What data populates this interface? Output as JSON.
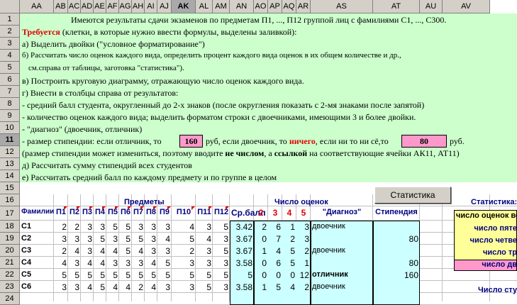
{
  "columns": [
    "AA",
    "AB",
    "AC",
    "AD",
    "AE",
    "AF",
    "AG",
    "AH",
    "AI",
    "AJ",
    "AK",
    "AL",
    "AM",
    "AN",
    "AO",
    "AP",
    "AQ",
    "AR",
    "AS",
    "AT",
    "AU",
    "AV"
  ],
  "selected_column": "AK",
  "rows": [
    "1",
    "2",
    "3",
    "4",
    "5",
    "6",
    "7",
    "8",
    "9",
    "10",
    "11",
    "12",
    "13",
    "14",
    "15",
    "16",
    "17",
    "18",
    "19",
    "20",
    "21",
    "22",
    "23",
    "24"
  ],
  "selected_row": "11",
  "task": {
    "line1": "Имеются результаты сдачи экзаменов по предметам П1, ..., П12 группой лиц с фамилиями С1, ..., С300.",
    "line2_red": "Требуется",
    "line2_rest": " (клетки, в которые нужно ввести формулы, выделены заливкой):",
    "line3": "а) Выделить двойки (\"условное форматирование\")",
    "line4": "б) Рассчитать число оценок каждого вида, определить процент каждого вида оценок в их общем количестве и др.,",
    "line5": "    см.справа от таблицы, заготовка \"статистика\").",
    "line6": "в) Построить круговую диаграмму, отражающую число оценок каждого вида.",
    "line7": "г) Внести в столбцы справа от результатов:",
    "line8": "   - средний балл студента, округленный до 2-х знаков (после округления показать с 2-мя знаками после запятой)",
    "line9": "   - количество оценок каждого вида; выделить форматом строки с двоечниками, имеющими 3 и более двойки.",
    "line10": "   - \"диагноз\" (двоечник, отличник)",
    "line11_a": "   - размер стипендии: если отличник, то",
    "line11_val1": "160",
    "line11_b": "руб, если двоечник, то",
    "line11_bold": "ничего",
    "line11_c": ", если ни то ни сё,то",
    "line11_val2": "80",
    "line11_d": "руб.",
    "line12_a": "     (размер стипендии может измениться, поэтому вводите",
    "line12_b1": "не числом",
    "line12_c": ", а",
    "line12_b2": "ссылкой",
    "line12_d": " на соответствующие ячейки АК11, АТ11)",
    "line13": "д) Рассчитать сумму стипендий всех студентов",
    "line14": "е) Рассчитать средний балл по каждому предмету и по группе в целом"
  },
  "button_label": "Статистика",
  "table": {
    "subjects_header": "Предметы",
    "counts_header": "Число оценок",
    "col_surname": "Фамилии",
    "subject_cols": [
      "П1",
      "П2",
      "П3",
      "П4",
      "П5",
      "П6",
      "П7",
      "П8",
      "П9",
      "П10",
      "П11",
      "П12"
    ],
    "col_avg": "Ср.балл",
    "grade_cols": [
      "2",
      "3",
      "4",
      "5"
    ],
    "col_diag": "\"Диагноз\"",
    "col_stip": "Стипендия",
    "rows": [
      {
        "name": "С1",
        "grades": [
          "2",
          "2",
          "3",
          "3",
          "5",
          "5",
          "3",
          "3",
          "3",
          "4",
          "3",
          "5"
        ],
        "avg": "3.42",
        "counts": [
          "2",
          "6",
          "1",
          "3"
        ],
        "diag": "двоечник",
        "stip": ""
      },
      {
        "name": "С2",
        "grades": [
          "3",
          "3",
          "3",
          "5",
          "3",
          "5",
          "5",
          "3",
          "4",
          "5",
          "4",
          "3"
        ],
        "avg": "3.67",
        "counts": [
          "0",
          "7",
          "2",
          "3"
        ],
        "diag": "",
        "stip": "80"
      },
      {
        "name": "С3",
        "grades": [
          "2",
          "4",
          "3",
          "4",
          "4",
          "5",
          "4",
          "3",
          "3",
          "2",
          "3",
          "5"
        ],
        "avg": "3.67",
        "counts": [
          "1",
          "4",
          "5",
          "2"
        ],
        "diag": "двоечник",
        "stip": ""
      },
      {
        "name": "С4",
        "grades": [
          "4",
          "3",
          "4",
          "4",
          "3",
          "3",
          "3",
          "4",
          "5",
          "3",
          "3",
          "3"
        ],
        "avg": "3.58",
        "counts": [
          "0",
          "6",
          "5",
          "1"
        ],
        "diag": "",
        "stip": "80"
      },
      {
        "name": "С5",
        "grades": [
          "5",
          "5",
          "5",
          "5",
          "5",
          "5",
          "5",
          "5",
          "5",
          "5",
          "5",
          "5"
        ],
        "avg": "5",
        "counts": [
          "0",
          "0",
          "0",
          "12"
        ],
        "diag": "отличник",
        "stip": "160"
      },
      {
        "name": "С6",
        "grades": [
          "3",
          "3",
          "4",
          "5",
          "4",
          "4",
          "2",
          "4",
          "3",
          "3",
          "5",
          "3"
        ],
        "avg": "3.58",
        "counts": [
          "1",
          "5",
          "4",
          "2"
        ],
        "diag": "двоечник",
        "stip": ""
      }
    ]
  },
  "stats": {
    "title": "Статистика:",
    "header": "число оценок все",
    "items": [
      "число пяте",
      "число четве",
      "число тр",
      "число дв"
    ],
    "footer": "Число студ"
  }
}
